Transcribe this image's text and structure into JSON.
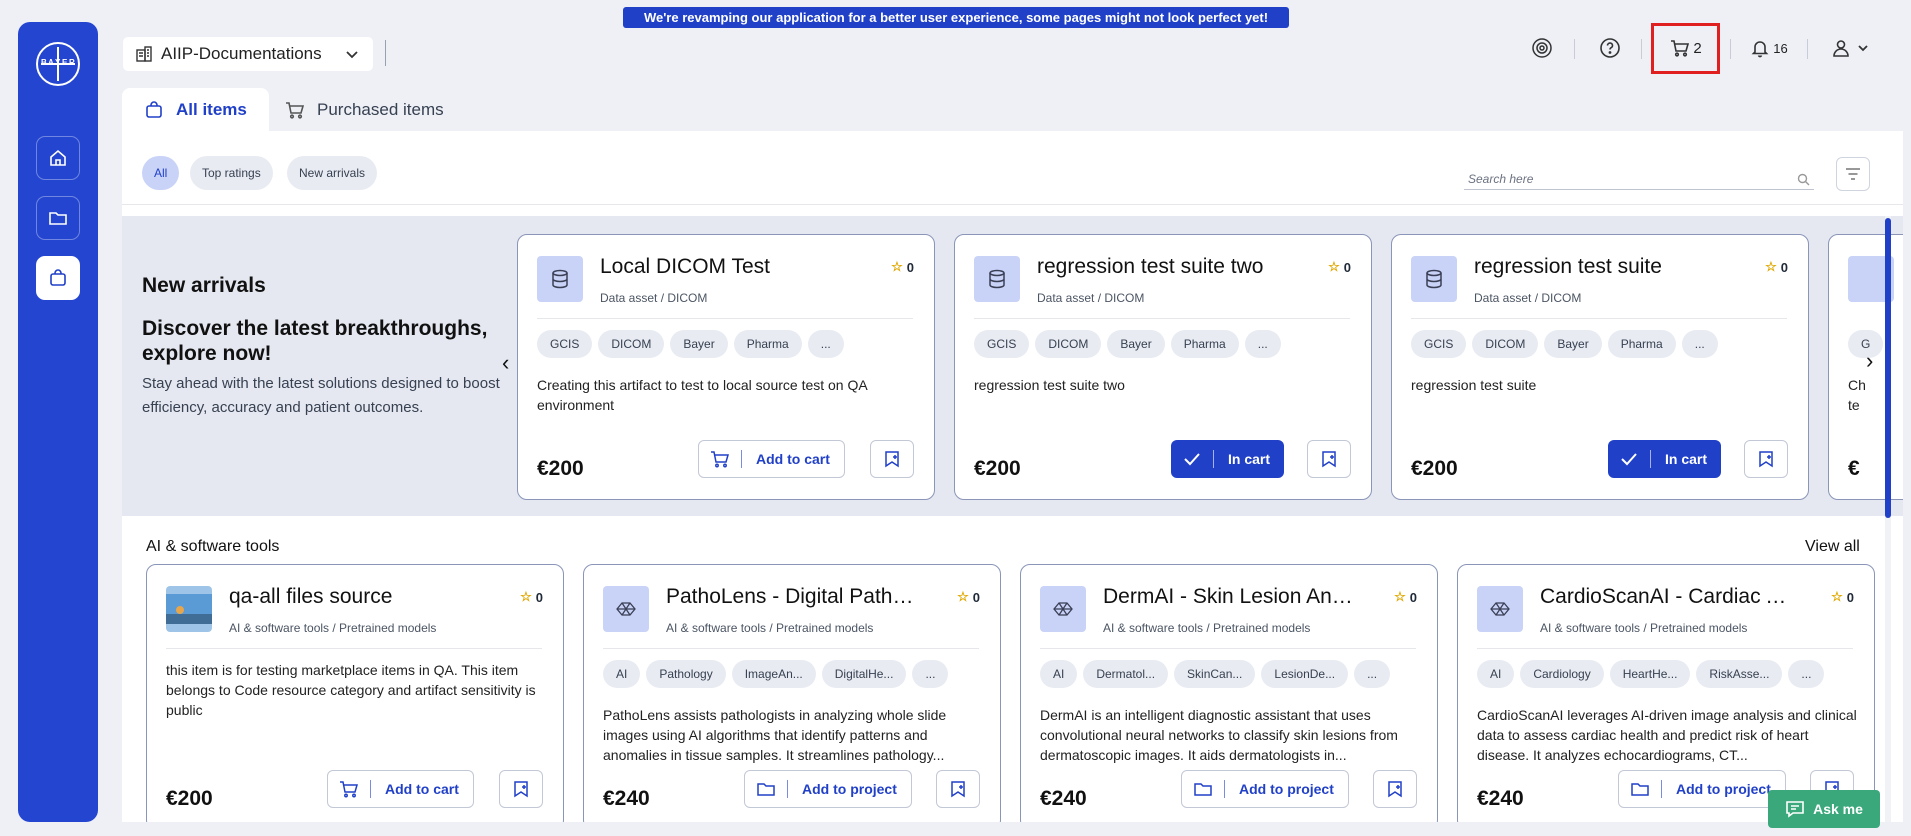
{
  "banner": "We're revamping our application for a better user experience, some pages might not look perfect yet!",
  "logo_text": "BAYER",
  "project": {
    "name": "AIIP-Documentations"
  },
  "header": {
    "cart_count": "2",
    "notification_count": "16"
  },
  "tabs": [
    {
      "label": "All items",
      "active": true
    },
    {
      "label": "Purchased items",
      "active": false
    }
  ],
  "filters": [
    "All",
    "Top ratings",
    "New arrivals"
  ],
  "search": {
    "placeholder": "Search here"
  },
  "new_arrivals": {
    "title": "New arrivals",
    "headline": "Discover the latest breakthroughs, explore now!",
    "description": "Stay ahead with the latest solutions designed to boost efficiency, accuracy and patient outcomes.",
    "cards": [
      {
        "title": "Local DICOM Test",
        "rating": "0",
        "category": "Data asset / DICOM",
        "tags": [
          "GCIS",
          "DICOM",
          "Bayer",
          "Pharma",
          "..."
        ],
        "description": "Creating this artifact to test to local source test on QA environment",
        "price": "€200",
        "action": "Add to cart",
        "in_cart": false
      },
      {
        "title": "regression test suite two",
        "rating": "0",
        "category": "Data asset / DICOM",
        "tags": [
          "GCIS",
          "DICOM",
          "Bayer",
          "Pharma",
          "..."
        ],
        "description": "regression test suite two",
        "price": "€200",
        "action": "In cart",
        "in_cart": true
      },
      {
        "title": "regression test suite",
        "rating": "0",
        "category": "Data asset / DICOM",
        "tags": [
          "GCIS",
          "DICOM",
          "Bayer",
          "Pharma",
          "..."
        ],
        "description": "regression test suite",
        "price": "€200",
        "action": "In cart",
        "in_cart": true
      },
      {
        "title": "",
        "rating": "",
        "category": "",
        "tags": [
          "G"
        ],
        "description": "Ch te",
        "price": "€",
        "action": "",
        "in_cart": false
      }
    ]
  },
  "ai_tools": {
    "title": "AI & software tools",
    "view_all": "View all",
    "cards": [
      {
        "title": "qa-all files source",
        "rating": "0",
        "category": "AI & software tools / Pretrained models",
        "tags": [],
        "description": "this item is for testing marketplace items in QA. This item belongs to Code resource category and artifact sensitivity is public",
        "price": "€200",
        "action": "Add to cart"
      },
      {
        "title": "PathoLens - Digital Pathology",
        "rating": "0",
        "category": "AI & software tools / Pretrained models",
        "tags": [
          "AI",
          "Pathology",
          "ImageAn...",
          "DigitalHe...",
          "..."
        ],
        "description": "PathoLens assists pathologists in analyzing whole slide images using AI algorithms that identify patterns and anomalies in tissue samples. It streamlines pathology...",
        "price": "€240",
        "action": "Add to project"
      },
      {
        "title": "DermAI - Skin Lesion Analysis",
        "rating": "0",
        "category": "AI & software tools / Pretrained models",
        "tags": [
          "AI",
          "Dermatol...",
          "SkinCan...",
          "LesionDe...",
          "..."
        ],
        "description": "DermAI is an intelligent diagnostic assistant that uses convolutional neural networks to classify skin lesions from dermatoscopic images. It aids dermatologists in...",
        "price": "€240",
        "action": "Add to project"
      },
      {
        "title": "CardioScanAI - Cardiac Analysis",
        "rating": "0",
        "category": "AI & software tools / Pretrained models",
        "tags": [
          "AI",
          "Cardiology",
          "HeartHe...",
          "RiskAsse...",
          "..."
        ],
        "description": "CardioScanAI leverages AI-driven image analysis and clinical data to assess cardiac health and predict risk of heart disease. It analyzes echocardiograms, CT...",
        "price": "€240",
        "action": "Add to project"
      }
    ]
  },
  "ask_me": "Ask me",
  "colors": {
    "primary": "#2140c8",
    "sidebar": "#2445d0",
    "highlight": "#e02020",
    "ask_me": "#3aa87b"
  }
}
